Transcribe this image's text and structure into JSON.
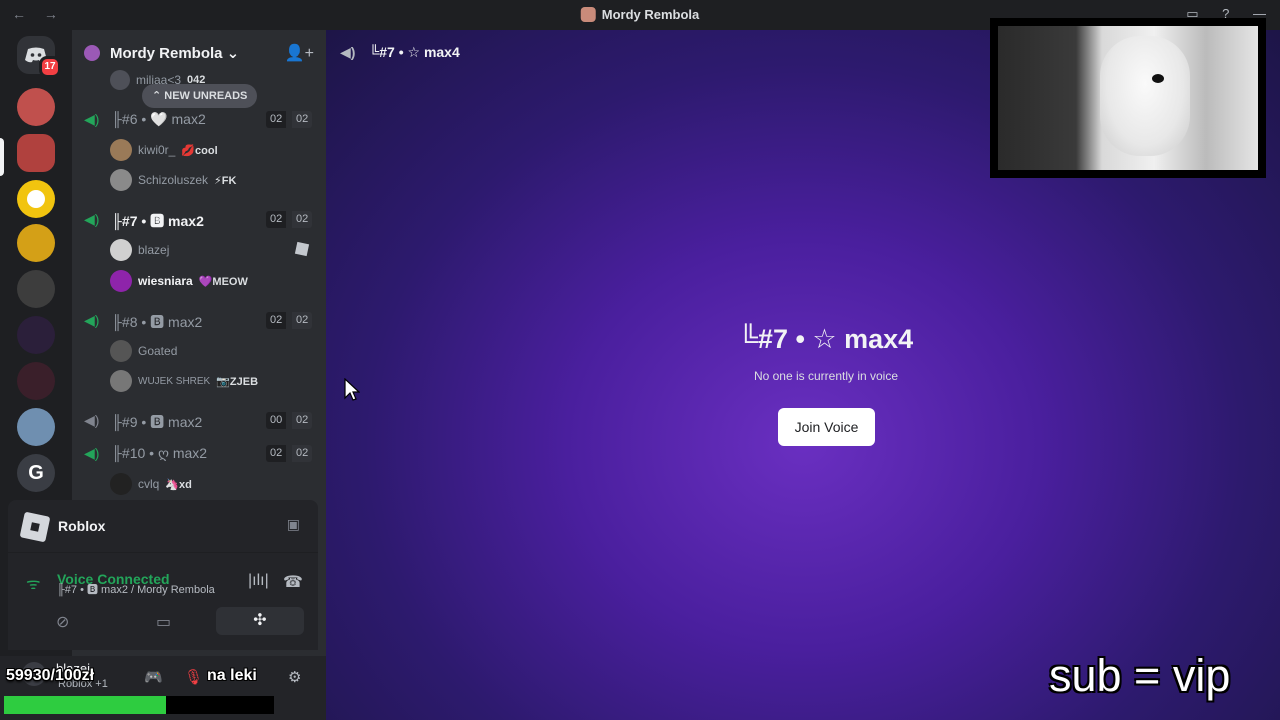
{
  "window": {
    "title": "Mordy Rembola",
    "back": "←",
    "forward": "→",
    "inbox_icon": "inbox-icon",
    "help_icon": "help-icon",
    "minimize": "—"
  },
  "rail": {
    "home_badge": "17",
    "servers": [
      "direct-messages",
      "server-1",
      "server-2",
      "server-3",
      "server-4",
      "server-5",
      "server-6",
      "server-7",
      "server-8",
      "server-9"
    ]
  },
  "server": {
    "name": "Mordy Rembola ⌄",
    "invite_icon": "add-member-icon"
  },
  "unreads": {
    "label": "⌃ NEW UNREADS"
  },
  "channels": [
    {
      "name": "╟#6 • 🤍 max2",
      "a": "02",
      "b": "02"
    },
    {
      "name": "╟#7 • 🅱 max2",
      "a": "02",
      "b": "02",
      "active": true
    },
    {
      "name": "╟#8 • 🅱 max2",
      "a": "02",
      "b": "02"
    },
    {
      "name": "╟#9 • 🅱 max2",
      "a": "00",
      "b": "02"
    },
    {
      "name": "╟#10 • ღ max2",
      "a": "02",
      "b": "02"
    }
  ],
  "members": {
    "top": {
      "name": "miliaa<3",
      "tag": "042"
    },
    "c6": [
      {
        "name": "kiwi0r_",
        "tag": "💋cool"
      },
      {
        "name": "Schizoluszek",
        "tag": "⚡FK"
      }
    ],
    "c7": [
      {
        "name": "blazej",
        "tag": ""
      },
      {
        "name": "wiesniara",
        "tag": "💜MEOW"
      }
    ],
    "c8": [
      {
        "name": "Goated",
        "tag": ""
      },
      {
        "name": "WUJEK SHREK",
        "tag": "📷ZJEB"
      }
    ],
    "c10": [
      {
        "name": "cvlq",
        "tag": "🦄xd"
      }
    ]
  },
  "activity": {
    "name": "Roblox"
  },
  "voice": {
    "status": "Voice Connected",
    "location": "╟#7 • 🅱 max2 / Mordy Rembola"
  },
  "user": {
    "name": "blazej",
    "status": "Roblox +1"
  },
  "overlay": {
    "count": "59930/100zł",
    "leki": "na leki",
    "progress": 0.6,
    "sub": "sub = vip"
  },
  "main": {
    "header": "╚#7 • ☆ max4",
    "title": "╚#7 • ☆ max4",
    "subtitle": "No one is currently in voice",
    "join": "Join Voice"
  },
  "colors": {
    "accent_green": "#23a55a",
    "bg": "#1e1f22",
    "progress_fill": "#2ecc40"
  }
}
